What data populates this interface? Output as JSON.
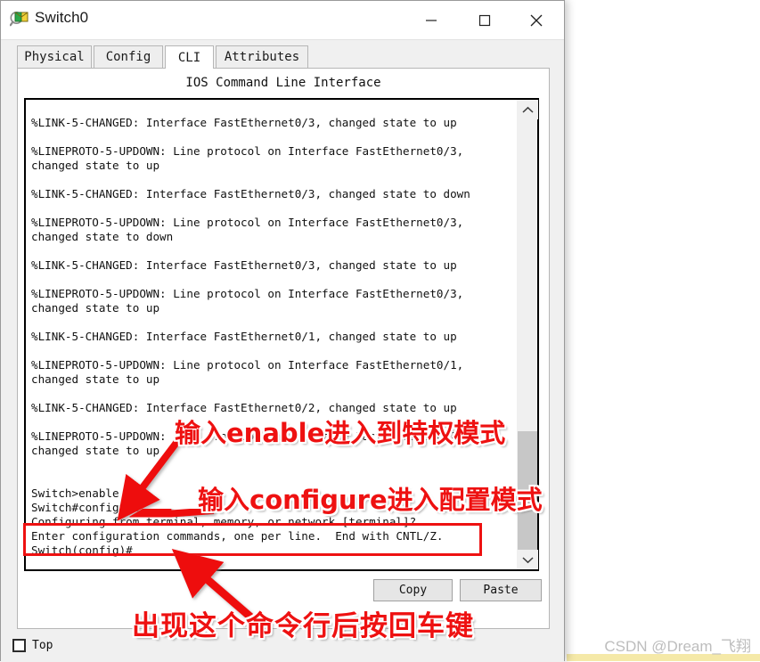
{
  "window": {
    "title": "Switch0",
    "icon": "switch-device-icon",
    "controls": {
      "minimize": "minimize-icon",
      "maximize": "maximize-icon",
      "close": "close-icon"
    }
  },
  "tabs": [
    {
      "id": "physical",
      "label": "Physical",
      "active": false
    },
    {
      "id": "config",
      "label": "Config",
      "active": false
    },
    {
      "id": "cli",
      "label": "CLI",
      "active": true
    },
    {
      "id": "attributes",
      "label": "Attributes",
      "active": false
    }
  ],
  "pane": {
    "heading": "IOS Command Line Interface"
  },
  "terminal": {
    "lines": [
      "",
      "%LINK-5-CHANGED: Interface FastEthernet0/3, changed state to up",
      "",
      "%LINEPROTO-5-UPDOWN: Line protocol on Interface FastEthernet0/3,",
      "changed state to up",
      "",
      "%LINK-5-CHANGED: Interface FastEthernet0/3, changed state to down",
      "",
      "%LINEPROTO-5-UPDOWN: Line protocol on Interface FastEthernet0/3,",
      "changed state to down",
      "",
      "%LINK-5-CHANGED: Interface FastEthernet0/3, changed state to up",
      "",
      "%LINEPROTO-5-UPDOWN: Line protocol on Interface FastEthernet0/3,",
      "changed state to up",
      "",
      "%LINK-5-CHANGED: Interface FastEthernet0/1, changed state to up",
      "",
      "%LINEPROTO-5-UPDOWN: Line protocol on Interface FastEthernet0/1,",
      "changed state to up",
      "",
      "%LINK-5-CHANGED: Interface FastEthernet0/2, changed state to up",
      "",
      "%LINEPROTO-5-UPDOWN: Line protocol on Interface FastEthernet0/2,",
      "changed state to up",
      "",
      "",
      "Switch>enable",
      "Switch#configure",
      "Configuring from terminal, memory, or network [terminal]?",
      "Enter configuration commands, one per line.  End with CNTL/Z.",
      "Switch(config)#"
    ],
    "scrollbar": {
      "up_arrow": "chevron-up-icon",
      "down_arrow": "chevron-down-icon"
    }
  },
  "buttons": {
    "copy": "Copy",
    "paste": "Paste"
  },
  "bottom": {
    "top_checkbox_label": "Top",
    "top_checkbox_checked": false
  },
  "annotations": {
    "enable_note": "输入enable进入到特权模式",
    "configure_note": "输入configure进入配置模式",
    "enter_note": "出现这个命令行后按回车键",
    "highlight_color": "#ee1111"
  },
  "watermark": {
    "text": "CSDN @Dream_飞翔"
  }
}
